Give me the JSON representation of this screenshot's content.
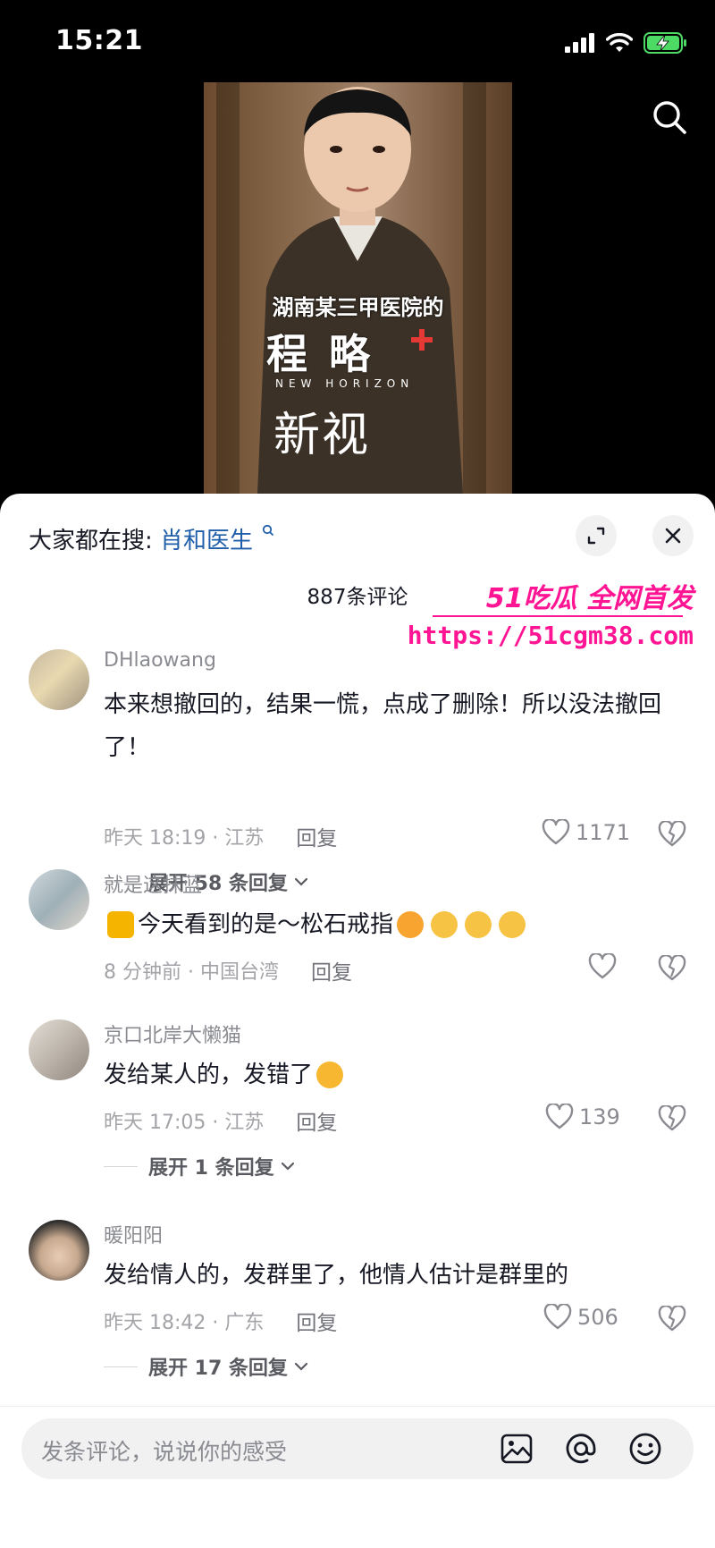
{
  "status_bar": {
    "time": "15:21"
  },
  "video": {
    "caption_line1": "湖南某三甲医院的",
    "caption_big": "程 略",
    "caption_sub": "NEW HORIZON",
    "caption_big2": "新视"
  },
  "panel": {
    "search_prefix": "大家都在搜:",
    "search_keyword": "肖和医生",
    "comment_count": "887条评论"
  },
  "watermark": {
    "top": "51吃瓜 全网首发",
    "url": "https://51cgm38.com"
  },
  "comments": [
    {
      "user": "DHlaowang",
      "text": "本来想撤回的，结果一慌，点成了删除！所以没法撤回了！",
      "time_loc": "昨天 18:19 · 江苏",
      "reply_label": "回复",
      "likes": "1171",
      "expand": "展开 58 条回复"
    },
    {
      "user": "就是这抹蓝",
      "text": "今天看到的是～松石戒指",
      "time_loc": "8 分钟前 · 中国台湾",
      "reply_label": "回复",
      "likes": ""
    },
    {
      "user": "京口北岸大懒猫",
      "text": "发给某人的，发错了",
      "time_loc": "昨天 17:05 · 江苏",
      "reply_label": "回复",
      "likes": "139",
      "expand": "展开 1 条回复"
    },
    {
      "user": "暖阳阳",
      "text": "发给情人的，发群里了，他情人估计是群里的",
      "time_loc": "昨天 18:42 · 广东",
      "reply_label": "回复",
      "likes": "506",
      "expand": "展开 17 条回复"
    }
  ],
  "input_bar": {
    "placeholder": "发条评论，说说你的感受"
  },
  "icons": {
    "signal": "signal-icon",
    "wifi": "wifi-icon",
    "battery": "battery-charging-icon",
    "search": "search-icon",
    "expand": "expand-icon",
    "close": "close-icon",
    "heart": "heart-icon",
    "dislike": "broken-heart-icon",
    "chevron": "chevron-down-icon",
    "image": "image-icon",
    "at": "at-icon",
    "emoji": "emoji-icon"
  },
  "colors": {
    "accent_link": "#1f5ea8",
    "watermark": "#ff1493",
    "battery_green": "#4cd964"
  }
}
